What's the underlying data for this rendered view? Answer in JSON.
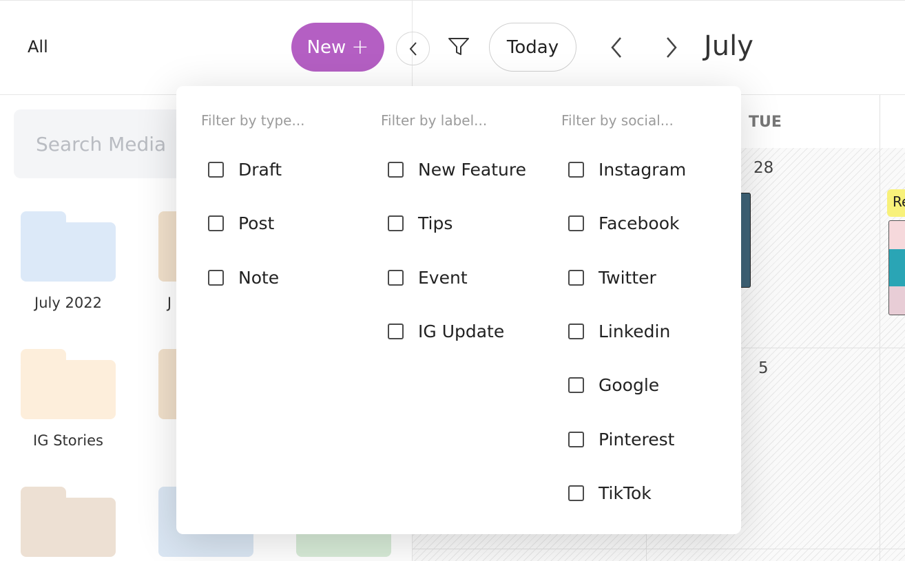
{
  "toolbar": {
    "view_label": "All",
    "new_label": "New",
    "new_icon": "+",
    "today_label": "Today",
    "month": "July"
  },
  "search": {
    "placeholder": "Search Media"
  },
  "folders": [
    {
      "label": "July 2022",
      "color": "#dce9f8"
    },
    {
      "label": "J",
      "color": "#f1e0cb"
    },
    {
      "label": "IG Stories",
      "color": "#fdeedb"
    },
    {
      "label": "",
      "color": "#f1e0cb"
    },
    {
      "label": "",
      "color": "#ede0d3"
    },
    {
      "label": "",
      "color": "#dae6f3"
    },
    {
      "label": "",
      "color": "#d7ebd7"
    }
  ],
  "calendar": {
    "day_header": "TUE",
    "dates": [
      "28",
      "5"
    ],
    "post_label": "Re"
  },
  "filter": {
    "type": {
      "title": "Filter by type...",
      "options": [
        "Draft",
        "Post",
        "Note"
      ]
    },
    "label": {
      "title": "Filter by label...",
      "options": [
        "New Feature",
        "Tips",
        "Event",
        "IG Update"
      ]
    },
    "social": {
      "title": "Filter by social...",
      "options": [
        "Instagram",
        "Facebook",
        "Twitter",
        "Linkedin",
        "Google",
        "Pinterest",
        "TikTok"
      ]
    }
  },
  "colors": {
    "accent": "#b45fc3",
    "checkbox_border": "#4a4a4a",
    "muted_text": "#9b9b9b"
  }
}
